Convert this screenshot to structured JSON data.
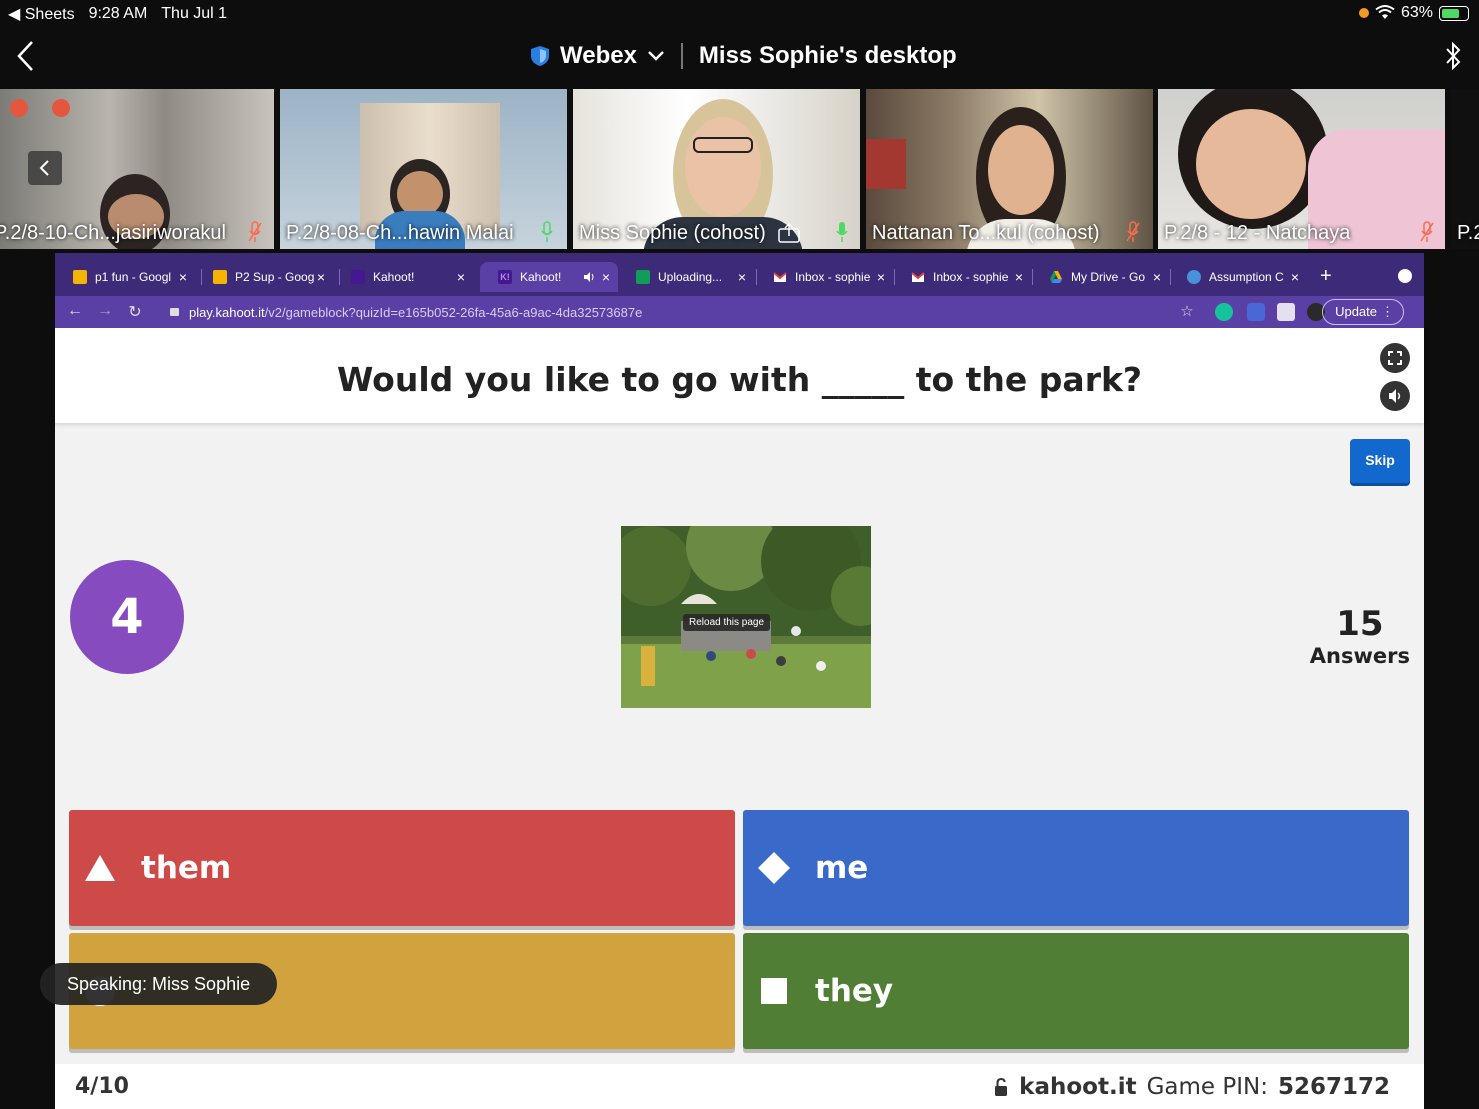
{
  "status_bar": {
    "back_app": "◀ Sheets",
    "time": "9:28 AM",
    "date": "Thu Jul 1",
    "battery": "63%"
  },
  "webex": {
    "app_name": "Webex",
    "meeting_title": "Miss Sophie's desktop"
  },
  "participants": [
    {
      "name": "P.2/8-10-Ch...jasiriworakul",
      "muted": true
    },
    {
      "name": "P.2/8-08-Ch...hawin Malai",
      "muted": false
    },
    {
      "name": "Miss Sophie (cohost)",
      "muted": false,
      "sharing": true
    },
    {
      "name": "Nattanan To...kul (cohost)",
      "muted": true
    },
    {
      "name": "P.2/8 - 12 - Natchaya",
      "muted": true
    },
    {
      "name": "P.2"
    }
  ],
  "browser": {
    "tabs": [
      {
        "label": "p1 fun - Googl",
        "icon": "slides-icon",
        "color": "#f4b400"
      },
      {
        "label": "P2 Sup - Goog",
        "icon": "slides-icon",
        "color": "#f4b400"
      },
      {
        "label": "Kahoot!",
        "icon": "kahoot-icon",
        "color": "#46178f"
      },
      {
        "label": "Kahoot!",
        "icon": "kahoot-icon",
        "color": "#46178f",
        "active": true
      },
      {
        "label": "Uploading...",
        "icon": "sheets-icon",
        "color": "#0f9d58"
      },
      {
        "label": "Inbox - sophie",
        "icon": "gmail-icon",
        "color": "#ea4335"
      },
      {
        "label": "Inbox - sophie",
        "icon": "gmail-icon",
        "color": "#ea4335"
      },
      {
        "label": "My Drive - Go",
        "icon": "drive-icon",
        "color": "#4285f4"
      },
      {
        "label": "Assumption C",
        "icon": "globe-icon",
        "color": "#4a90d9"
      }
    ],
    "url_host": "play.kahoot.it",
    "url_path": "/v2/gameblock?quizId=e165b052-26fa-45a6-a9ac-4da32573687e",
    "update_label": "Update"
  },
  "kahoot": {
    "question": "Would you like to go with _____ to the park?",
    "skip_label": "Skip",
    "timer": "4",
    "image_tooltip": "Reload this page",
    "answers_count": "15",
    "answers_label": "Answers",
    "choices": [
      {
        "label": "them",
        "shape": "triangle",
        "color": "#ce4a48"
      },
      {
        "label": "me",
        "shape": "diamond",
        "color": "#3a6ac9"
      },
      {
        "label": "",
        "shape": "circle",
        "color": "#d1a33f"
      },
      {
        "label": "they",
        "shape": "square",
        "color": "#4f7e34"
      }
    ],
    "progress": "4/10",
    "site": "kahoot.it",
    "pin_label": "Game PIN:",
    "pin": "5267172"
  },
  "speaking_indicator": "Speaking: Miss Sophie"
}
